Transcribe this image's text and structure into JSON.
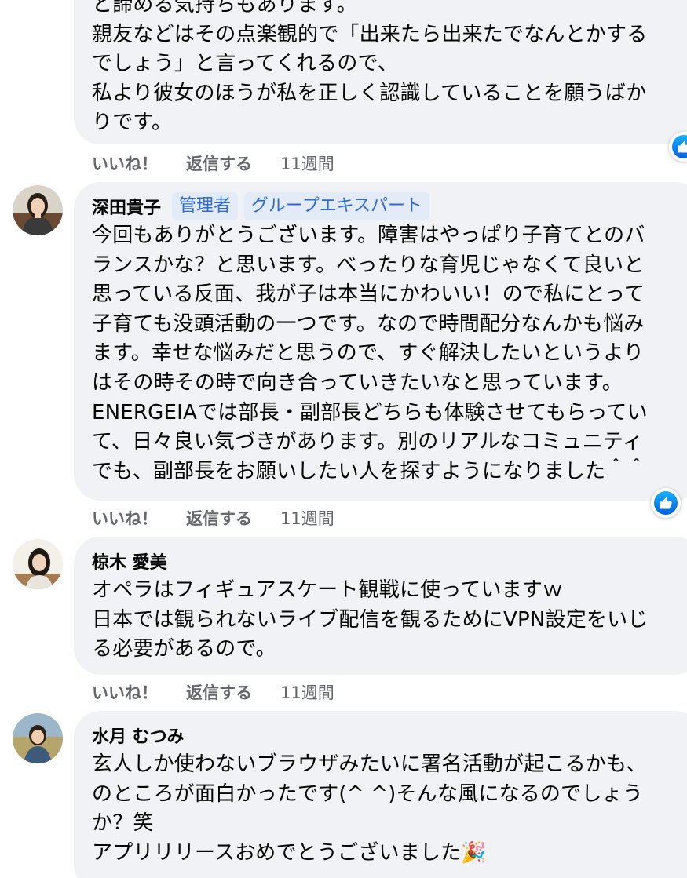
{
  "comments": [
    {
      "author": "",
      "text": "と諦める気持ちもあります。\n親友などはその点楽観的で「出来たら出来たでなんとかする\nでしょう」と言ってくれるので、\n私より彼女のほうが私を正しく認識していることを願うばか\nりです。",
      "actions": {
        "like": "いいね！",
        "reply": "返信する",
        "time": "11週間"
      }
    },
    {
      "author": "深田貴子",
      "badges": [
        "管理者",
        "グループエキスパート"
      ],
      "text": "今回もありがとうございます。障害はやっぱり子育てとのバ\nランスかな？と思います。べったりな育児じゃなくて良いと\n思っている反面、我が子は本当にかわいい！ので私にとって\n子育ても没頭活動の一つです。なので時間配分なんかも悩み\nます。幸せな悩みだと思うので、すぐ解決したいというより\nはその時その時で向き合っていきたいなと思っています。\nENERGEIAでは部長・副部長どちらも体験させてもらってい\nて、日々良い気づきがあります。別のリアルなコミュニティ\nでも、副部長をお願いしたい人を探すようになりました＾＾",
      "actions": {
        "like": "いいね！",
        "reply": "返信する",
        "time": "11週間"
      }
    },
    {
      "author": "椋木 愛美",
      "text": "オペラはフィギュアスケート観戦に使っていますｗ\n日本では観られないライブ配信を観るためにVPN設定をいじ\nる必要があるので。",
      "actions": {
        "like": "いいね！",
        "reply": "返信する",
        "time": "11週間"
      }
    },
    {
      "author": "水月 むつみ",
      "text": "玄人しか使わないブラウザみたいに署名活動が起こるかも、\nのところが面白かったです(^ ^)そんな風になるのでしょう\nか？笑\nアプリリリースおめでとうございました🎉",
      "actions": {}
    }
  ],
  "colors": {
    "bubble": "#f0f2f5",
    "badge_bg": "#e3ebf9",
    "badge_text": "#2d6ad3",
    "meta": "#65676b",
    "like_blue": "#0866ff"
  },
  "icons": [
    "like-reaction-icon",
    "party-popper-emoji"
  ]
}
